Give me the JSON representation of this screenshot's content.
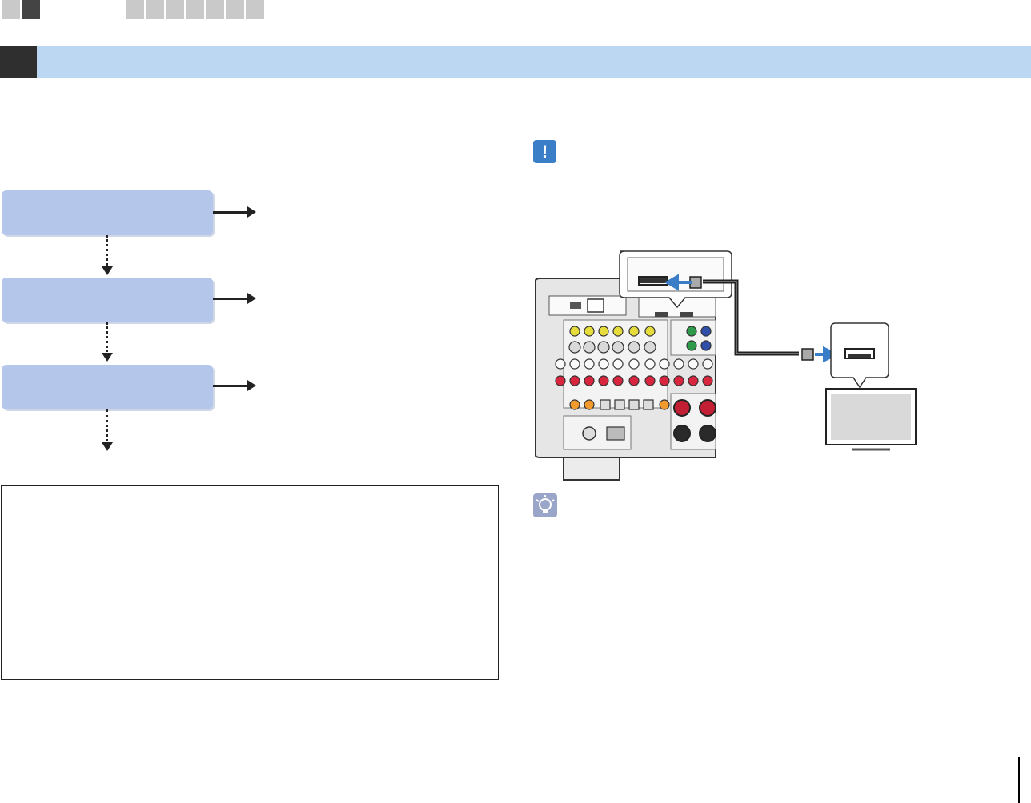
{
  "nav": {
    "tabs_left": [
      {
        "state": "light"
      },
      {
        "state": "dark"
      }
    ],
    "tabs_right": [
      {
        "state": "light"
      },
      {
        "state": "light"
      },
      {
        "state": "light"
      },
      {
        "state": "light"
      },
      {
        "state": "light"
      },
      {
        "state": "light"
      },
      {
        "state": "light"
      }
    ]
  },
  "colors": {
    "header_bar": "#bcd7f1",
    "step_box": "#b4c6ea",
    "caution_icon": "#3a7ec8",
    "hint_icon": "#9aa6c9",
    "signal_arrow": "#3a7ec8"
  },
  "icons": {
    "caution": "exclamation-icon",
    "hint": "lightbulb-icon"
  },
  "caution_symbol": "!"
}
